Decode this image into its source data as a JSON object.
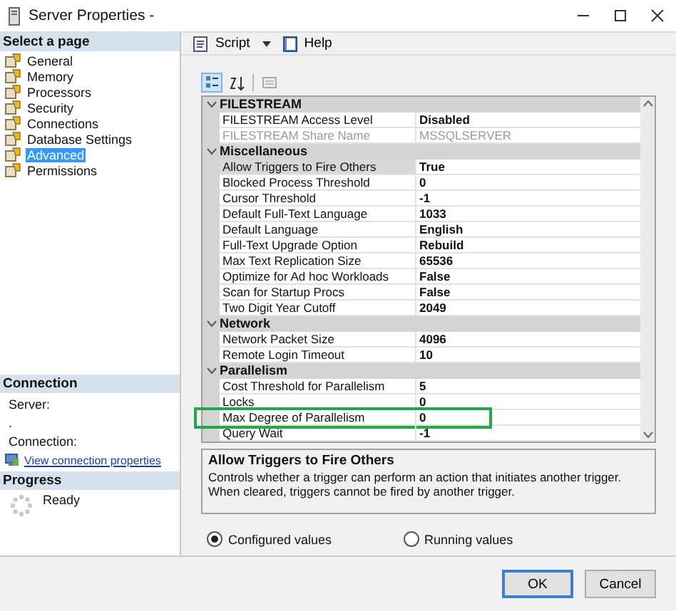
{
  "window": {
    "title": "Server Properties -"
  },
  "sidebar": {
    "heading": "Select a page",
    "items": [
      {
        "label": "General",
        "selected": false
      },
      {
        "label": "Memory",
        "selected": false
      },
      {
        "label": "Processors",
        "selected": false
      },
      {
        "label": "Security",
        "selected": false
      },
      {
        "label": "Connections",
        "selected": false
      },
      {
        "label": "Database Settings",
        "selected": false
      },
      {
        "label": "Advanced",
        "selected": true
      },
      {
        "label": "Permissions",
        "selected": false
      }
    ]
  },
  "connection": {
    "heading": "Connection",
    "server_label": "Server:",
    "server_value": ".",
    "connection_label": "Connection:",
    "link": "View connection properties"
  },
  "progress": {
    "heading": "Progress",
    "status": "Ready"
  },
  "toolbar": {
    "script": "Script",
    "help": "Help"
  },
  "grid": {
    "categories": [
      {
        "name": "FILESTREAM",
        "expanded": true,
        "rows": [
          {
            "name": "FILESTREAM Access Level",
            "value": "Disabled",
            "disabled": false,
            "selected": false,
            "highlighted": false
          },
          {
            "name": "FILESTREAM Share Name",
            "value": "MSSQLSERVER",
            "disabled": true,
            "selected": false,
            "highlighted": false
          }
        ]
      },
      {
        "name": "Miscellaneous",
        "expanded": true,
        "rows": [
          {
            "name": "Allow Triggers to Fire Others",
            "value": "True",
            "disabled": false,
            "selected": true,
            "highlighted": false
          },
          {
            "name": "Blocked Process Threshold",
            "value": "0",
            "disabled": false,
            "selected": false,
            "highlighted": false
          },
          {
            "name": "Cursor Threshold",
            "value": "-1",
            "disabled": false,
            "selected": false,
            "highlighted": false
          },
          {
            "name": "Default Full-Text Language",
            "value": "1033",
            "disabled": false,
            "selected": false,
            "highlighted": false
          },
          {
            "name": "Default Language",
            "value": "English",
            "disabled": false,
            "selected": false,
            "highlighted": false
          },
          {
            "name": "Full-Text Upgrade Option",
            "value": "Rebuild",
            "disabled": false,
            "selected": false,
            "highlighted": false
          },
          {
            "name": "Max Text Replication Size",
            "value": "65536",
            "disabled": false,
            "selected": false,
            "highlighted": false
          },
          {
            "name": "Optimize for Ad hoc Workloads",
            "value": "False",
            "disabled": false,
            "selected": false,
            "highlighted": false
          },
          {
            "name": "Scan for Startup Procs",
            "value": "False",
            "disabled": false,
            "selected": false,
            "highlighted": false
          },
          {
            "name": "Two Digit Year Cutoff",
            "value": "2049",
            "disabled": false,
            "selected": false,
            "highlighted": false
          }
        ]
      },
      {
        "name": "Network",
        "expanded": true,
        "rows": [
          {
            "name": "Network Packet Size",
            "value": "4096",
            "disabled": false,
            "selected": false,
            "highlighted": false
          },
          {
            "name": "Remote Login Timeout",
            "value": "10",
            "disabled": false,
            "selected": false,
            "highlighted": false
          }
        ]
      },
      {
        "name": "Parallelism",
        "expanded": true,
        "rows": [
          {
            "name": "Cost Threshold for Parallelism",
            "value": "5",
            "disabled": false,
            "selected": false,
            "highlighted": false
          },
          {
            "name": "Locks",
            "value": "0",
            "disabled": false,
            "selected": false,
            "highlighted": false
          },
          {
            "name": "Max Degree of Parallelism",
            "value": "0",
            "disabled": false,
            "selected": false,
            "highlighted": true
          },
          {
            "name": "Query Wait",
            "value": "-1",
            "disabled": false,
            "selected": false,
            "highlighted": false
          }
        ]
      }
    ]
  },
  "description": {
    "title": "Allow Triggers to Fire Others",
    "text": "Controls whether a trigger can perform an action that initiates another trigger. When cleared, triggers cannot be fired by another trigger."
  },
  "radios": [
    {
      "label": "Configured values",
      "selected": true
    },
    {
      "label": "Running values",
      "selected": false
    }
  ],
  "buttons": [
    {
      "label": "OK",
      "kind": "default"
    },
    {
      "label": "Cancel",
      "kind": "normal"
    }
  ]
}
